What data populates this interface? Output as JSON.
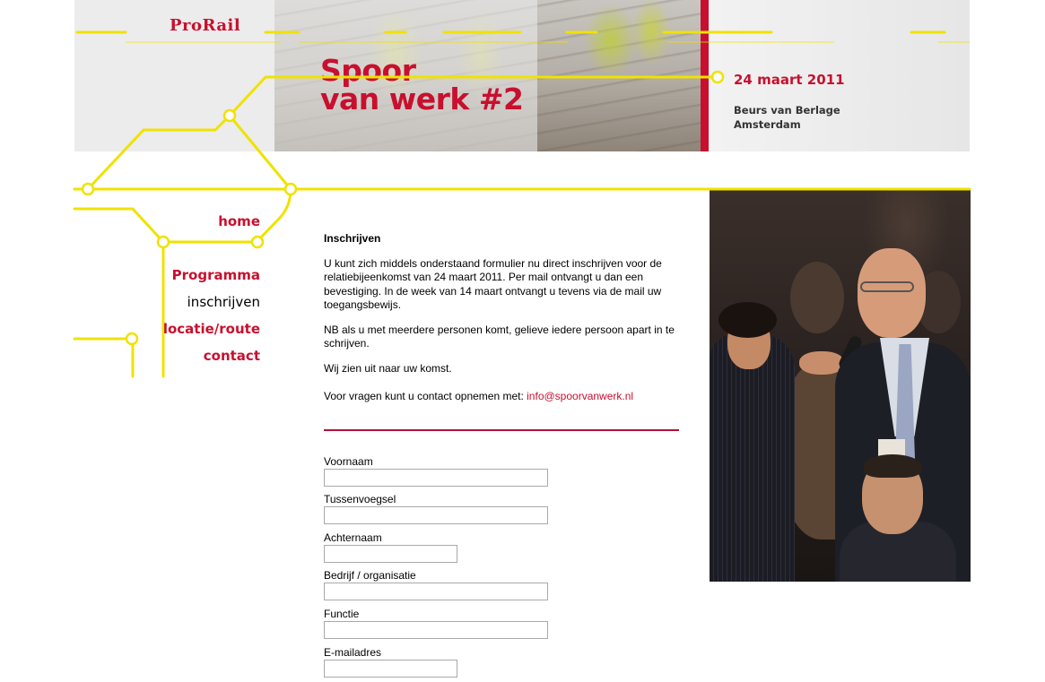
{
  "header": {
    "logo": "ProRail",
    "title_line1": "Spoor",
    "title_line2": "van werk #2",
    "date": "24 maart 2011",
    "venue_line1": "Beurs van Berlage",
    "venue_line2": "Amsterdam"
  },
  "nav": {
    "items": [
      {
        "label": "home"
      },
      {
        "label": "Programma"
      },
      {
        "label": "inschrijven"
      },
      {
        "label": "locatie/route"
      },
      {
        "label": "contact"
      }
    ]
  },
  "content": {
    "heading": "Inschrijven",
    "p1": "U kunt zich middels onderstaand formulier nu direct inschrijven voor de relatiebijeenkomst van 24 maart 2011. Per mail ontvangt u dan een bevestiging. In de week van 14 maart ontvangt u tevens via de mail uw toegangsbewijs.",
    "p2": "NB als u met meerdere personen komt, gelieve iedere persoon apart in te schrijven.",
    "p3": "Wij zien uit naar uw komst.",
    "p4_prefix": "Voor vragen kunt u contact opnemen met: ",
    "email": "info@spoorvanwerk.nl"
  },
  "form": {
    "fields": [
      {
        "label": "Voornaam",
        "value": ""
      },
      {
        "label": "Tussenvoegsel",
        "value": ""
      },
      {
        "label": "Achternaam",
        "value": ""
      },
      {
        "label": "Bedrijf / organisatie",
        "value": ""
      },
      {
        "label": "Functie",
        "value": ""
      },
      {
        "label": "E-mailadres",
        "value": ""
      }
    ]
  },
  "colors": {
    "accent": "#c8102e",
    "line": "#f0e200"
  },
  "icons": {
    "side_photo": "event-interview-photo",
    "header_photo": "railway-workers-photo"
  }
}
